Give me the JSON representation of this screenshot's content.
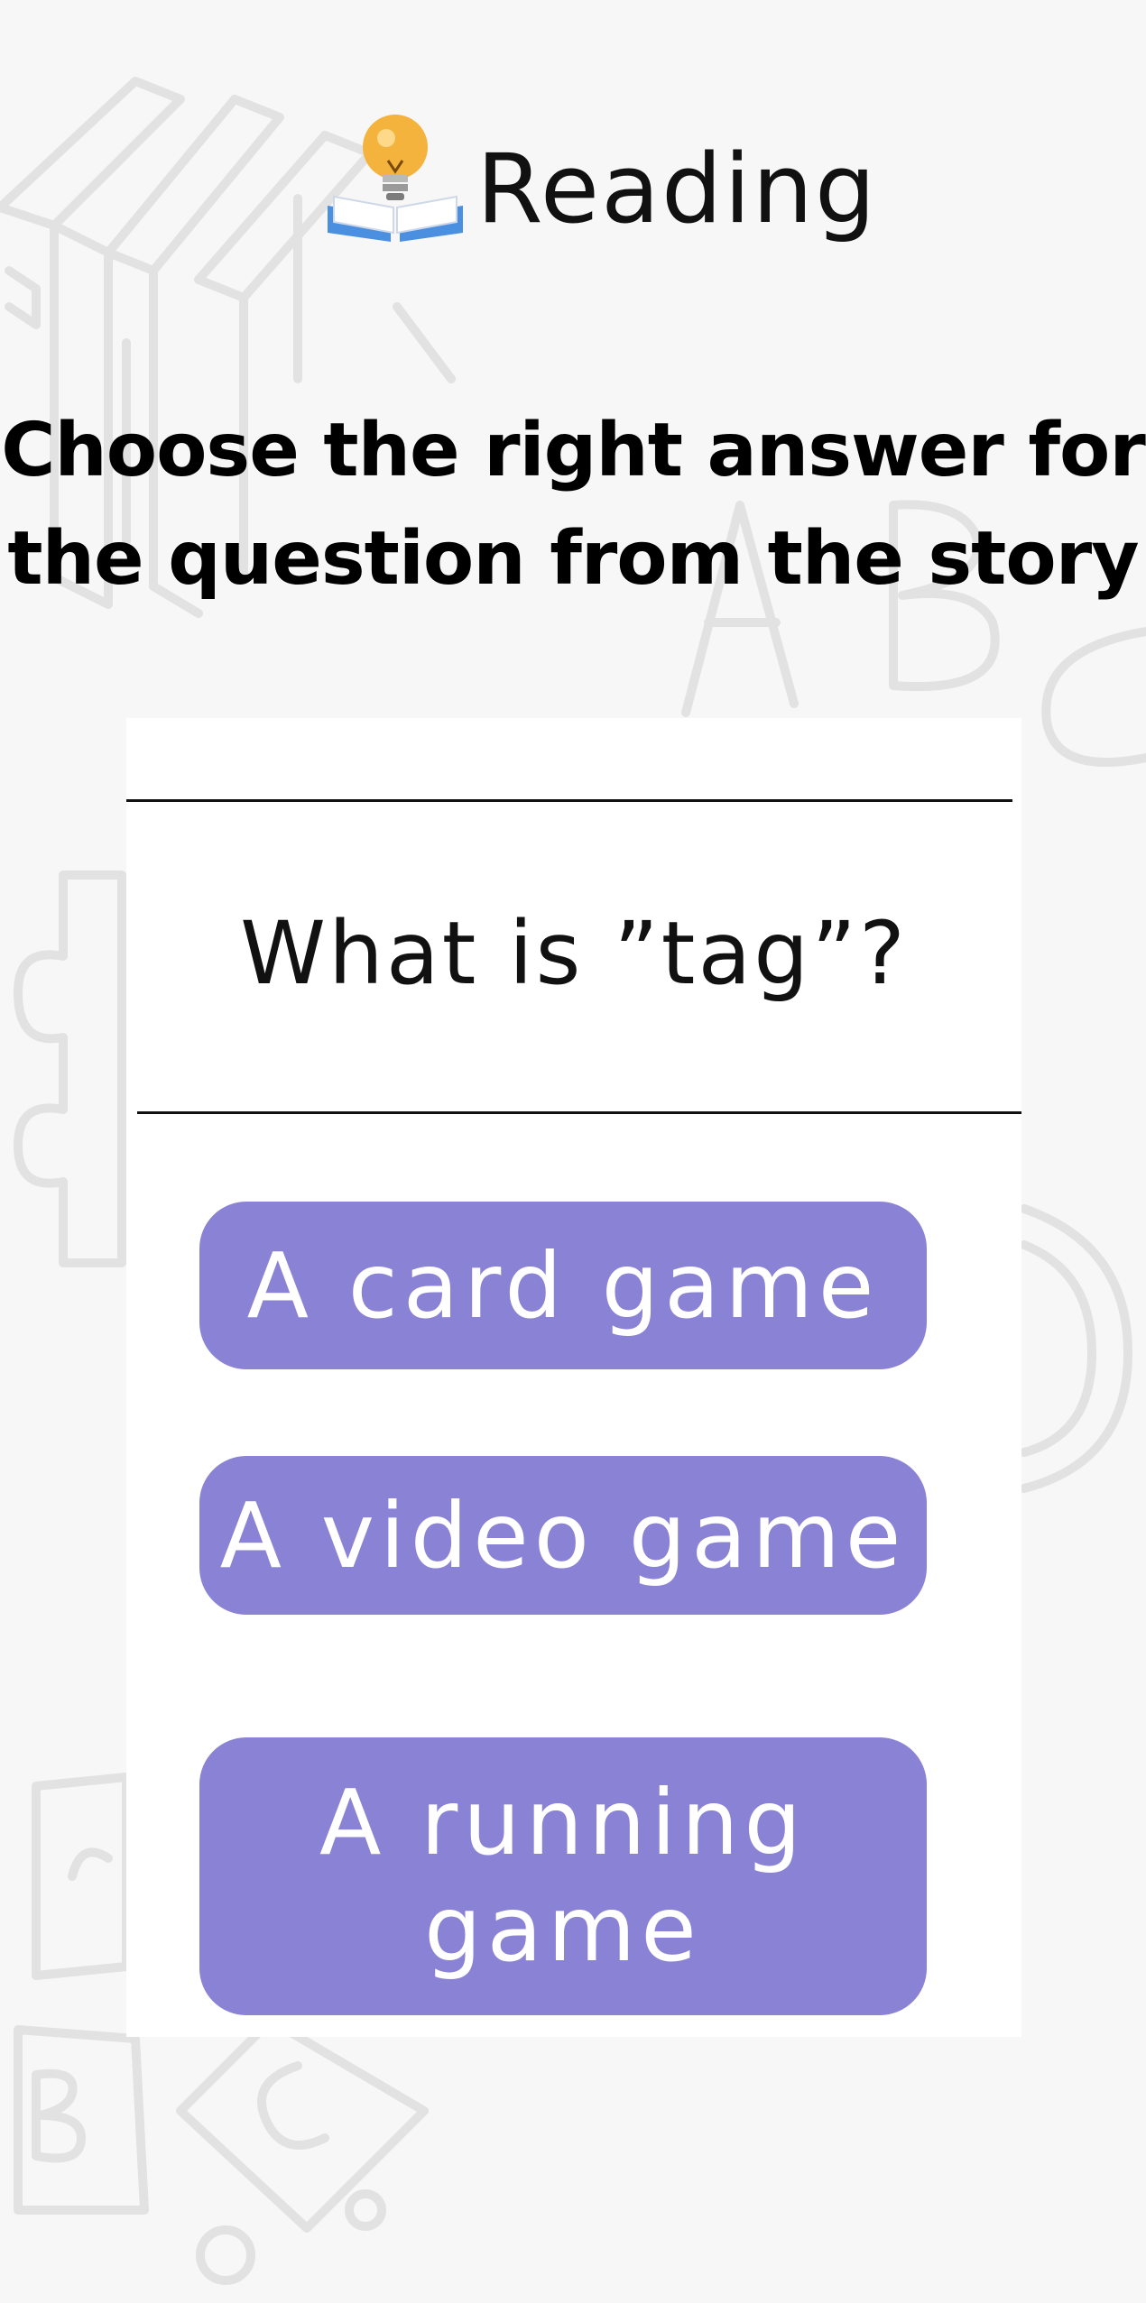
{
  "header": {
    "title": "Reading",
    "icon": "book-lightbulb-icon"
  },
  "instruction": "Choose the right answer for the question from the story",
  "quiz": {
    "question": "What is ”tag”?",
    "options": [
      {
        "label": "A card game"
      },
      {
        "label": "A video game"
      },
      {
        "label": "A running game"
      }
    ]
  },
  "colors": {
    "background": "#f7f7f7",
    "card": "#ffffff",
    "option_button": "#8a82d5",
    "option_text": "#ffffff",
    "text": "#111111"
  }
}
